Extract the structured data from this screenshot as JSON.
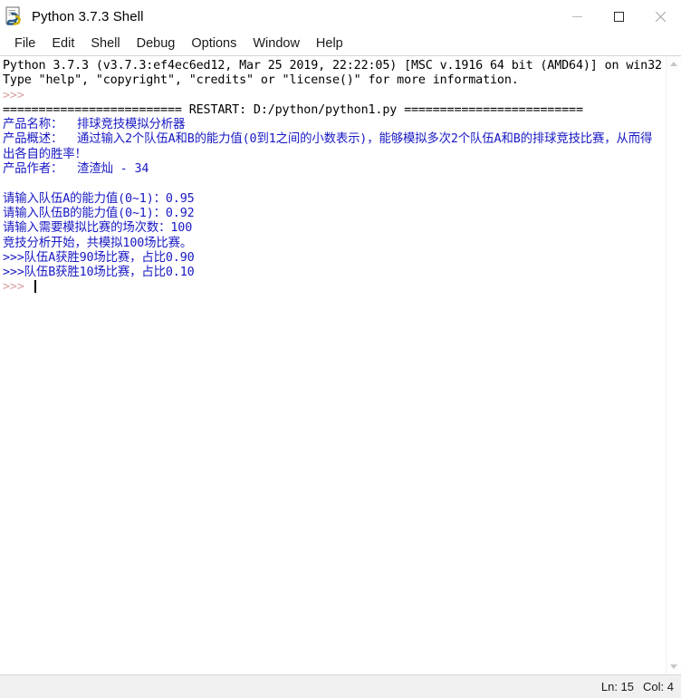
{
  "window": {
    "title": "Python 3.7.3 Shell",
    "icon": "python-idle-icon",
    "controls": {
      "minimize": "minimize-icon",
      "maximize": "maximize-icon",
      "close": "close-icon"
    }
  },
  "menubar": {
    "items": [
      {
        "label": "File"
      },
      {
        "label": "Edit"
      },
      {
        "label": "Shell"
      },
      {
        "label": "Debug"
      },
      {
        "label": "Options"
      },
      {
        "label": "Window"
      },
      {
        "label": "Help"
      }
    ]
  },
  "shell": {
    "lines": [
      {
        "color": "black",
        "text": "Python 3.7.3 (v3.7.3:ef4ec6ed12, Mar 25 2019, 22:22:05) [MSC v.1916 64 bit (AMD64)] on win32"
      },
      {
        "color": "black",
        "text": "Type \"help\", \"copyright\", \"credits\" or \"license()\" for more information."
      },
      {
        "color": "prompt",
        "text": ">>> "
      },
      {
        "color": "black",
        "text": "========================= RESTART: D:/python/python1.py ========================="
      },
      {
        "color": "blue",
        "text": "产品名称：  排球竞技模拟分析器"
      },
      {
        "color": "blue",
        "text": "产品概述：  通过输入2个队伍A和B的能力值(0到1之间的小数表示)，能够模拟多次2个队伍A和B的排球竞技比赛，从而得出各自的胜率！"
      },
      {
        "color": "blue",
        "text": "产品作者：  渣渣灿 - 34"
      },
      {
        "color": "blue",
        "text": ""
      },
      {
        "color": "blue",
        "text": "请输入队伍A的能力值(0~1)：0.95"
      },
      {
        "color": "blue",
        "text": "请输入队伍B的能力值(0~1)：0.92"
      },
      {
        "color": "blue",
        "text": "请输入需要模拟比赛的场次数：100"
      },
      {
        "color": "blue",
        "text": "竞技分析开始，共模拟100场比赛。"
      },
      {
        "color": "blue",
        "text": ">>>队伍A获胜90场比赛，占比0.90"
      },
      {
        "color": "blue",
        "text": ">>>队伍B获胜10场比赛，占比0.10"
      },
      {
        "color": "prompt",
        "text": ">>> ",
        "caret": true
      }
    ],
    "colors": {
      "stdout": "#1818c4",
      "prompt": "#d8a0a0",
      "stderr": "#000000",
      "background": "#ffffff"
    }
  },
  "scrollbar": {
    "up_arrow": "chevron-up-icon",
    "down_arrow": "chevron-down-icon"
  },
  "statusbar": {
    "line_label": "Ln: 15",
    "col_label": "Col: 4"
  }
}
